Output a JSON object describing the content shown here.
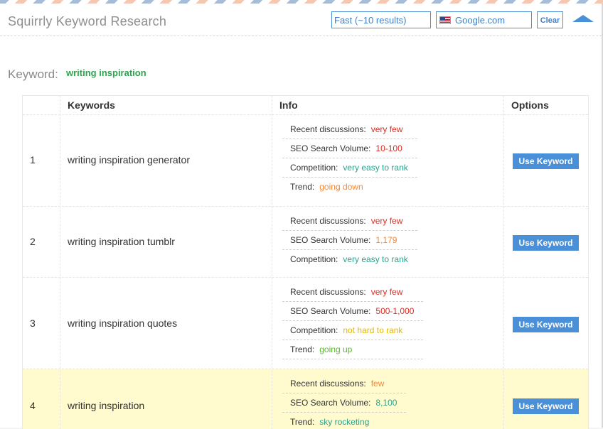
{
  "header": {
    "title": "Squirrly Keyword Research",
    "speed_value": "Fast (~10 results)",
    "engine_value": "Google.com",
    "clear_label": "Clear"
  },
  "keyword": {
    "label": "Keyword:",
    "value": "writing inspiration"
  },
  "table": {
    "columns": [
      "",
      "Keywords",
      "Info",
      "Options"
    ],
    "button_label": "Use Keyword",
    "rows": [
      {
        "num": "1",
        "keyword": "writing inspiration generator",
        "info": [
          {
            "label": "Recent discussions:",
            "value": "very few",
            "color": "#e02b20"
          },
          {
            "label": "SEO Search Volume:",
            "value": "10-100",
            "color": "#e02b20"
          },
          {
            "label": "Competition:",
            "value": "very easy to rank",
            "color": "#2aa38c"
          },
          {
            "label": "Trend:",
            "value": "going down",
            "color": "#f08a3b"
          }
        ]
      },
      {
        "num": "2",
        "keyword": "writing inspiration tumblr",
        "info": [
          {
            "label": "Recent discussions:",
            "value": "very few",
            "color": "#e02b20"
          },
          {
            "label": "SEO Search Volume:",
            "value": "1,179",
            "color": "#f08a3b"
          },
          {
            "label": "Competition:",
            "value": "very easy to rank",
            "color": "#2aa38c"
          }
        ]
      },
      {
        "num": "3",
        "keyword": "writing inspiration quotes",
        "info": [
          {
            "label": "Recent discussions:",
            "value": "very few",
            "color": "#e02b20"
          },
          {
            "label": "SEO Search Volume:",
            "value": "500-1,000",
            "color": "#e02b20"
          },
          {
            "label": "Competition:",
            "value": "not hard to rank",
            "color": "#e5b800"
          },
          {
            "label": "Trend:",
            "value": "going up",
            "color": "#5cb82e"
          }
        ]
      },
      {
        "num": "4",
        "keyword": "writing inspiration",
        "info": [
          {
            "label": "Recent discussions:",
            "value": "few",
            "color": "#f08a3b"
          },
          {
            "label": "SEO Search Volume:",
            "value": "8,100",
            "color": "#2aa38c"
          },
          {
            "label": "Trend:",
            "value": "sky rocketing",
            "color": "#2aa38c"
          }
        ]
      }
    ]
  },
  "colors": {
    "accent": "#4a90d9",
    "keyword_green": "#2ea44f",
    "highlight_row": "#fffbcf"
  }
}
